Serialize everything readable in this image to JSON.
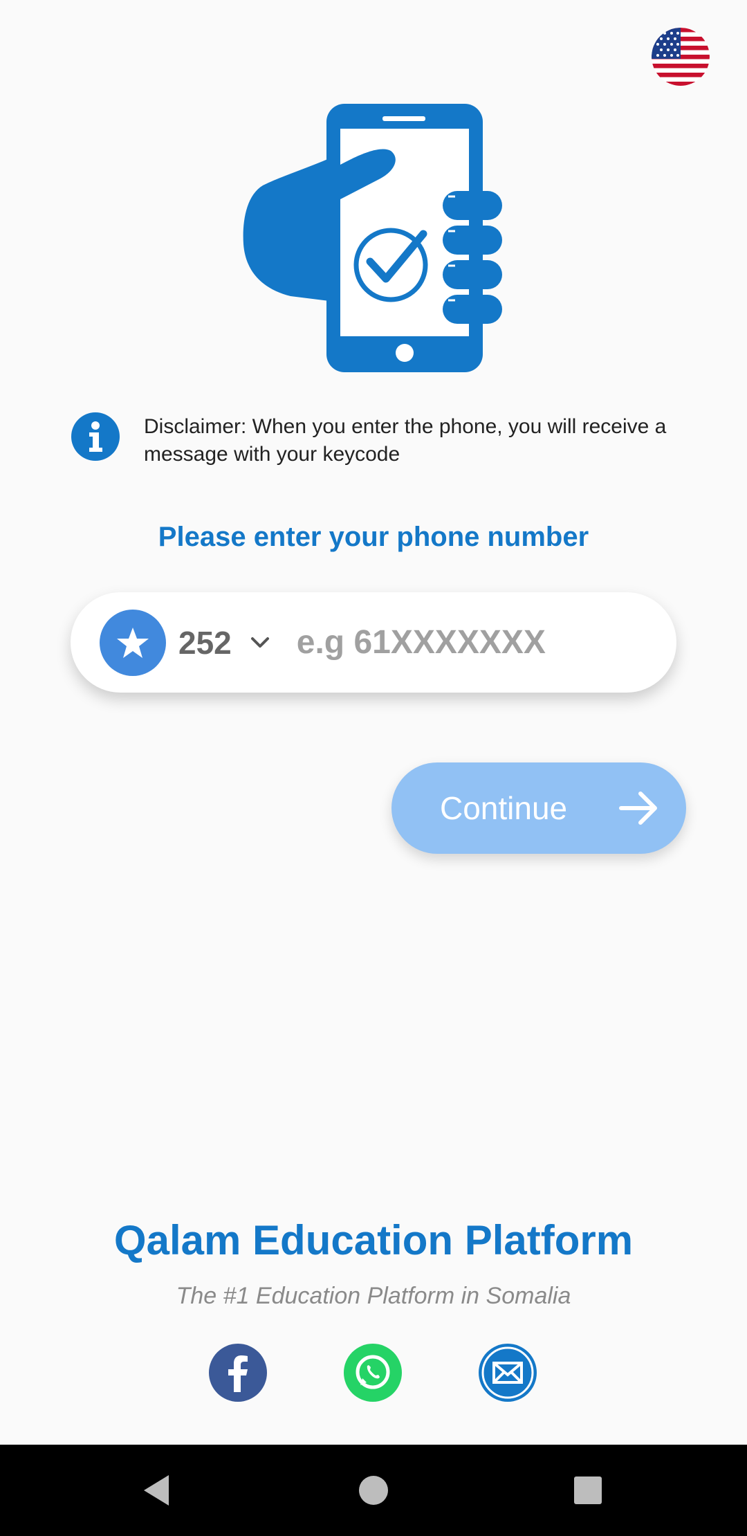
{
  "language": {
    "icon": "us-flag-icon"
  },
  "disclaimer": {
    "icon": "info-icon",
    "text": "Disclaimer: When you enter the phone, you will receive a message with your keycode"
  },
  "prompt": "Please enter your phone number",
  "phone": {
    "country_flag": "somalia-flag-icon",
    "country_code": "252",
    "value": "",
    "placeholder": "e.g 61XXXXXXX"
  },
  "continue_button": {
    "label": "Continue",
    "icon": "arrow-right-icon"
  },
  "brand": {
    "title": "Qalam Education Platform",
    "tagline": "The #1 Education Platform in Somalia"
  },
  "social": [
    {
      "name": "facebook",
      "icon": "facebook-icon",
      "color": "#3b5998"
    },
    {
      "name": "whatsapp",
      "icon": "whatsapp-icon",
      "color": "#25d366"
    },
    {
      "name": "email",
      "icon": "mail-icon",
      "color": "#1478c8"
    }
  ],
  "colors": {
    "primary": "#1478c8",
    "button_disabled": "#91c1f4",
    "background": "#fafafa"
  }
}
